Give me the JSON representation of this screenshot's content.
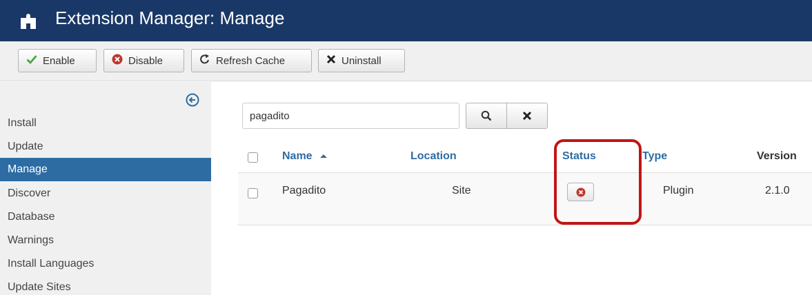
{
  "header": {
    "title": "Extension Manager: Manage",
    "icon": "puzzle-icon",
    "background": "#1a3867"
  },
  "toolbar": {
    "enable_label": "Enable",
    "disable_label": "Disable",
    "refresh_label": "Refresh Cache",
    "uninstall_label": "Uninstall"
  },
  "sidebar": {
    "items": [
      {
        "label": "Install"
      },
      {
        "label": "Update"
      },
      {
        "label": "Manage",
        "active": true
      },
      {
        "label": "Discover"
      },
      {
        "label": "Database"
      },
      {
        "label": "Warnings"
      },
      {
        "label": "Install Languages"
      },
      {
        "label": "Update Sites"
      }
    ],
    "active_color": "#2d6ca2"
  },
  "search": {
    "value": "pagadito"
  },
  "table": {
    "columns": {
      "name": "Name",
      "location": "Location",
      "status": "Status",
      "type": "Type",
      "version": "Version"
    },
    "rows": [
      {
        "name": "Pagadito",
        "location": "Site",
        "status": "disabled",
        "type": "Plugin",
        "version": "2.1.0"
      }
    ]
  },
  "colors": {
    "link": "#2d6ca2",
    "enable_check": "#46a546",
    "disable_icon": "#bd362f",
    "highlight": "#c01515"
  }
}
